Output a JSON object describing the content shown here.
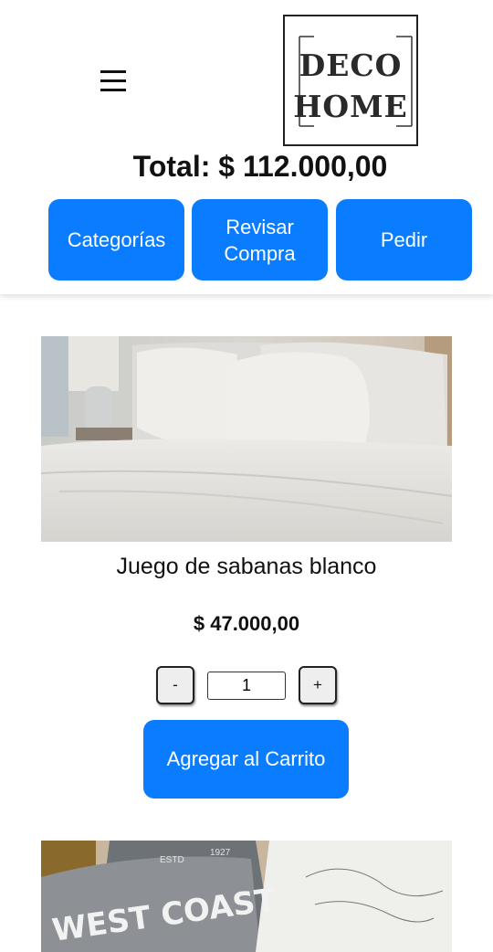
{
  "header": {
    "logo_line1": "DECO",
    "logo_line2": "HOME",
    "total": "Total: $ 112.000,00"
  },
  "nav": {
    "categorias": "Categorías",
    "revisar": "Revisar Compra",
    "pedir": "Pedir"
  },
  "product": {
    "name": "Juego de sabanas blanco",
    "price": "$ 47.000,00",
    "decrement": "-",
    "increment": "+",
    "quantity": "1",
    "add_to_cart": "Agregar al Carrito"
  },
  "next_product": {
    "image_text": "WEST COAST",
    "image_tag1": "ESTD",
    "image_tag2": "1927"
  },
  "colors": {
    "accent": "#0a7cff"
  }
}
